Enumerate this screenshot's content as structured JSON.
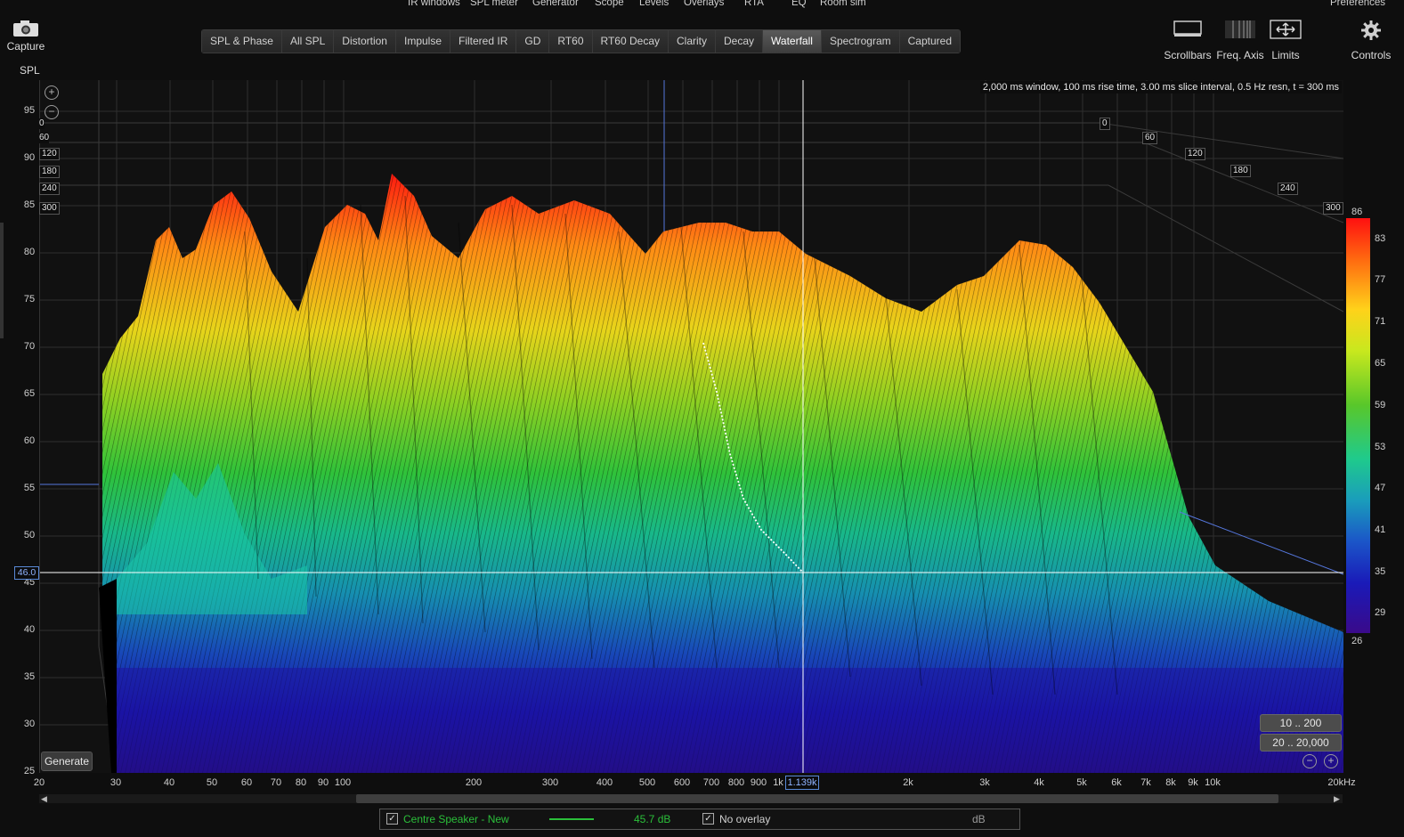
{
  "top_menu": [
    "IR windows",
    "SPL meter",
    "Generator",
    "Scope",
    "Levels",
    "Overlays",
    "RTA",
    "EQ",
    "Room sim",
    "Preferences"
  ],
  "capture": {
    "label": "Capture"
  },
  "tabs": [
    {
      "label": "SPL & Phase"
    },
    {
      "label": "All SPL"
    },
    {
      "label": "Distortion"
    },
    {
      "label": "Impulse"
    },
    {
      "label": "Filtered IR"
    },
    {
      "label": "GD"
    },
    {
      "label": "RT60"
    },
    {
      "label": "RT60 Decay"
    },
    {
      "label": "Clarity"
    },
    {
      "label": "Decay"
    },
    {
      "label": "Waterfall"
    },
    {
      "label": "Spectrogram"
    },
    {
      "label": "Captured"
    }
  ],
  "active_tab": "Waterfall",
  "right_tools": {
    "scrollbars": "Scrollbars",
    "freq_axis": "Freq. Axis",
    "limits": "Limits",
    "controls": "Controls"
  },
  "y_axis": {
    "label": "SPL",
    "ticks": [
      "95",
      "90",
      "85",
      "80",
      "75",
      "70",
      "65",
      "60",
      "55",
      "50",
      "45",
      "40",
      "35",
      "30",
      "25"
    ]
  },
  "cursor_value": "46.0",
  "time_labels_left": [
    "0",
    "60",
    "120",
    "180",
    "240",
    "300"
  ],
  "time_labels_right": [
    "0",
    "60",
    "120",
    "180",
    "240",
    "300"
  ],
  "info": "2,000 ms window, 100 ms rise time, 3.00 ms slice interval, 0.5 Hz resn, t = 300 ms",
  "color_scale": [
    "86",
    "83",
    "77",
    "71",
    "65",
    "59",
    "53",
    "47",
    "41",
    "35",
    "29",
    "26"
  ],
  "x_axis": {
    "ticks": [
      "20",
      "30",
      "40",
      "50",
      "60",
      "70",
      "80",
      "90",
      "100",
      "200",
      "300",
      "400",
      "500",
      "600",
      "700",
      "800",
      "900",
      "1k",
      "2k",
      "3k",
      "4k",
      "5k",
      "6k",
      "7k",
      "8k",
      "9k",
      "10k",
      "20kHz"
    ],
    "cursor": "1.139k"
  },
  "buttons": {
    "generate": "Generate",
    "range_1": "10 .. 200",
    "range_2": "20 .. 20,000"
  },
  "legend": {
    "measurement": "Centre Speaker - New",
    "level": "45.7 dB",
    "overlay": "No overlay",
    "unit": "dB",
    "trace_color": "#2bbf3a"
  }
}
